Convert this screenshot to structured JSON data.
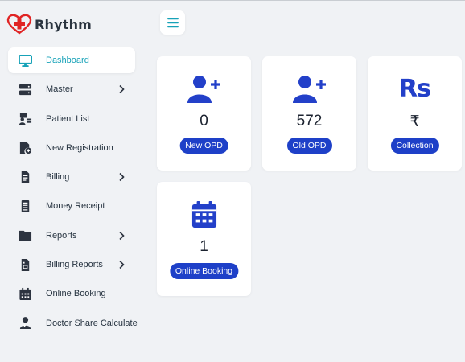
{
  "app": {
    "name": "Rhythm"
  },
  "colors": {
    "accent": "#17a2b8",
    "badge": "#1e40c8",
    "icon_blue": "#2340c9",
    "brand_red": "#e02424"
  },
  "sidebar": {
    "items": [
      {
        "label": "Dashboard",
        "icon": "monitor-icon",
        "active": true,
        "has_submenu": false
      },
      {
        "label": "Master",
        "icon": "server-icon",
        "has_submenu": true
      },
      {
        "label": "Patient List",
        "icon": "id-card-icon",
        "has_submenu": false
      },
      {
        "label": "New Registration",
        "icon": "file-add-icon",
        "has_submenu": false
      },
      {
        "label": "Billing",
        "icon": "bill-icon",
        "has_submenu": true
      },
      {
        "label": "Money Receipt",
        "icon": "receipt-icon",
        "has_submenu": false
      },
      {
        "label": "Reports",
        "icon": "folder-icon",
        "has_submenu": true
      },
      {
        "label": "Billing Reports",
        "icon": "report-file-icon",
        "has_submenu": true
      },
      {
        "label": "Online Booking",
        "icon": "calendar-icon",
        "has_submenu": false
      },
      {
        "label": "Doctor Share Calculate",
        "icon": "doctor-icon",
        "has_submenu": false
      }
    ]
  },
  "cards": [
    {
      "value": "0",
      "label": "New OPD",
      "icon": "user-plus-icon"
    },
    {
      "value": "572",
      "label": "Old OPD",
      "icon": "user-plus-icon"
    },
    {
      "value": "₹",
      "label": "Collection",
      "icon": "rupee-rs-icon",
      "icon_text": "Rs"
    },
    {
      "value": "1",
      "label": "Online Booking",
      "icon": "calendar-icon"
    }
  ]
}
